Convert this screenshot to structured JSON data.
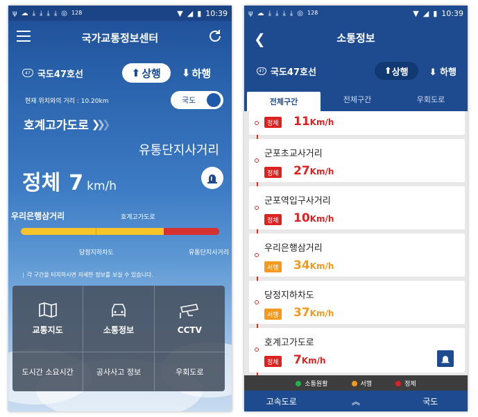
{
  "left": {
    "status_bar": {
      "badge": "128",
      "time": "10:39"
    },
    "header": {
      "title": "국가교통정보센터"
    },
    "route": {
      "badge": "47",
      "name": "국도47호선",
      "dir_up": "상행",
      "dir_down": "하행"
    },
    "distance": "현재 위치와의 거리 : 10.20km",
    "toggle_label": "국도",
    "segment": {
      "from": "호계고가도로",
      "to": "유통단지사거리"
    },
    "status": {
      "label": "정체",
      "speed": "7",
      "unit": "km/h"
    },
    "bar": {
      "left_label": "우리은행삼거리",
      "top_label": "호계고가도로",
      "bottom_mid": "당정지하차도",
      "bottom_right": "유통단지사거리"
    },
    "hint": "각 구간을 터치하시면 자세한 정보를 보실 수 있습니다.",
    "menu": {
      "row1": [
        {
          "label": "교통지도",
          "icon": "map-icon"
        },
        {
          "label": "소통정보",
          "icon": "car-icon"
        },
        {
          "label": "CCTV",
          "icon": "cctv-icon"
        }
      ],
      "row2": [
        {
          "label": "도시간 소요시간"
        },
        {
          "label": "공사사고 정보"
        },
        {
          "label": "우회도로"
        }
      ]
    }
  },
  "right": {
    "status_bar": {
      "badge": "128",
      "time": "10:39"
    },
    "header": {
      "title": "소통정보"
    },
    "route": {
      "badge": "47",
      "name": "국도47호선",
      "dir_up": "상행",
      "dir_down": "하행"
    },
    "tabs": [
      "전체구간",
      "전체구간",
      "우회도로"
    ],
    "items": [
      {
        "name": "",
        "status": "정체",
        "speed": "11",
        "unit": "Km/h",
        "color": "#dd2222"
      },
      {
        "name": "군포초교사거리",
        "status": "정체",
        "speed": "27",
        "unit": "Km/h",
        "color": "#dd2222"
      },
      {
        "name": "군포역입구사거리",
        "status": "정체",
        "speed": "10",
        "unit": "Km/h",
        "color": "#dd2222"
      },
      {
        "name": "우리은행삼거리",
        "status": "서행",
        "speed": "34",
        "unit": "Km/h",
        "color": "#f39a1e"
      },
      {
        "name": "당정지하차도",
        "status": "서행",
        "speed": "37",
        "unit": "Km/h",
        "color": "#f39a1e"
      },
      {
        "name": "호계고가도로",
        "status": "정체",
        "speed": "7",
        "unit": "Km/h",
        "color": "#dd2222"
      }
    ],
    "legend": [
      {
        "label": "소통원활",
        "color": "#22b14c"
      },
      {
        "label": "서행",
        "color": "#f39a1e"
      },
      {
        "label": "정체",
        "color": "#dd2222"
      }
    ],
    "bottom_nav": {
      "left": "고속도로",
      "right": "국도"
    }
  }
}
